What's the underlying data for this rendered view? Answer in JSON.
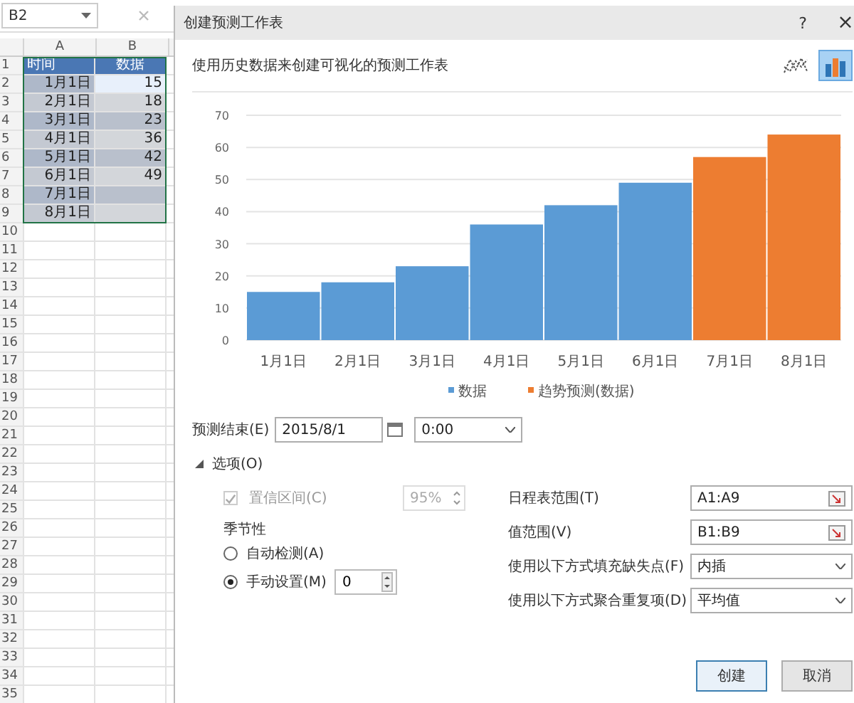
{
  "sheet": {
    "name_box": "B2",
    "columns": [
      "A",
      "B"
    ],
    "rows": [
      {
        "number": "1",
        "time": "时间",
        "value": "数据",
        "kind": "header"
      },
      {
        "number": "2",
        "time": "1月1日",
        "value": "15",
        "kind": "data",
        "active": true
      },
      {
        "number": "3",
        "time": "2月1日",
        "value": "18",
        "kind": "data",
        "active": false
      },
      {
        "number": "4",
        "time": "3月1日",
        "value": "23",
        "kind": "data",
        "active": false
      },
      {
        "number": "5",
        "time": "4月1日",
        "value": "36",
        "kind": "data",
        "active": false
      },
      {
        "number": "6",
        "time": "5月1日",
        "value": "42",
        "kind": "data",
        "active": false
      },
      {
        "number": "7",
        "time": "6月1日",
        "value": "49",
        "kind": "data",
        "active": false
      },
      {
        "number": "8",
        "time": "7月1日",
        "kind": "data",
        "active": false
      },
      {
        "number": "9",
        "time": "8月1日",
        "kind": "data",
        "active": false
      }
    ],
    "empty_rows": [
      "10",
      "11",
      "12",
      "13",
      "14",
      "15",
      "16",
      "17",
      "18",
      "19",
      "20",
      "21",
      "22",
      "23",
      "24",
      "25",
      "26",
      "27",
      "28",
      "29",
      "30",
      "31",
      "32",
      "33",
      "34",
      "35"
    ]
  },
  "dialog": {
    "title": "创建预测工作表",
    "help": "?",
    "close": "×",
    "description": "使用历史数据来创建可视化的预测工作表",
    "chart_types": [
      {
        "kind": "line",
        "selected": false
      },
      {
        "kind": "column",
        "selected": true
      }
    ],
    "chart_data": {
      "type": "bar",
      "categories": [
        "1月1日",
        "2月1日",
        "3月1日",
        "4月1日",
        "5月1日",
        "6月1日",
        "7月1日",
        "8月1日"
      ],
      "series": [
        {
          "name": "数据",
          "color": "#5b9bd5",
          "values": [
            15,
            18,
            23,
            36,
            42,
            49,
            null,
            null
          ]
        },
        {
          "name": "趋势预测(数据)",
          "color": "#ed7d31",
          "values": [
            null,
            null,
            null,
            null,
            null,
            null,
            57,
            64
          ]
        }
      ],
      "stacked": true,
      "grid": true,
      "legend": true,
      "ylim": [
        0,
        70
      ],
      "yticks": [
        0,
        10,
        20,
        30,
        40,
        50,
        60,
        70
      ]
    },
    "forecast_end": {
      "label": "预测结束(E)",
      "date": "2015/8/1",
      "time": "0:00"
    },
    "options": {
      "label": "选项(O)",
      "expanded": true,
      "confidence": {
        "label": "置信区间(C)",
        "checked": true,
        "disabled": true,
        "value": "95%"
      },
      "seasonality": {
        "label": "季节性",
        "choices": [
          {
            "label": "自动检测(A)",
            "selected": false
          },
          {
            "label": "手动设置(M)",
            "selected": true
          }
        ],
        "value": "0"
      },
      "fields": [
        {
          "kind": "range",
          "label": "日程表范围(T)",
          "value": "A1:A9"
        },
        {
          "kind": "range",
          "label": "值范围(V)",
          "value": "B1:B9"
        },
        {
          "kind": "dropdown",
          "label": "使用以下方式填充缺失点(F)",
          "value": "内插"
        },
        {
          "kind": "dropdown",
          "label": "使用以下方式聚合重复项(D)",
          "value": "平均值"
        }
      ]
    },
    "buttons": [
      {
        "label": "创建",
        "default": true
      },
      {
        "label": "取消",
        "default": false
      }
    ]
  }
}
